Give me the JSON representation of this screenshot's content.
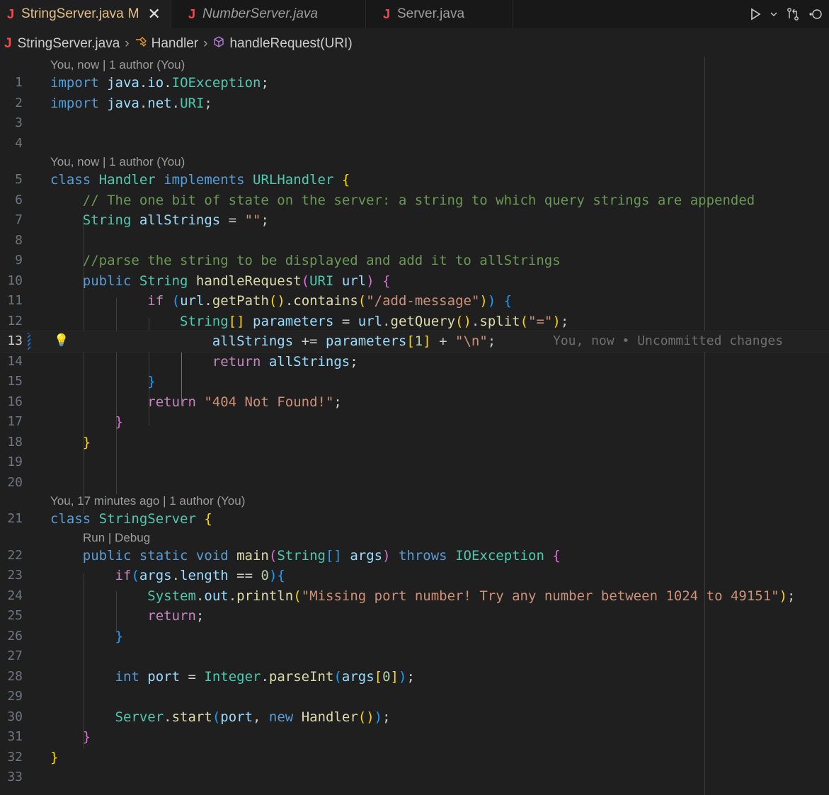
{
  "tabs": [
    {
      "icon": "J",
      "label": "StringServer.java",
      "modified": "M",
      "active": true
    },
    {
      "icon": "J",
      "label": "NumberServer.java",
      "active": false
    },
    {
      "icon": "J",
      "label": "Server.java",
      "active": false
    }
  ],
  "breadcrumb": {
    "file": "StringServer.java",
    "class": "Handler",
    "method": "handleRequest(URI)"
  },
  "codelens": {
    "handler_blame": "You, now | 1 author (You)",
    "server_blame": "You, 17 minutes ago | 1 author (You)",
    "run_debug": "Run | Debug"
  },
  "inline_blame": "You, now • Uncommitted changes",
  "current_line": 13,
  "lines": [
    {
      "n": "1",
      "tokens": [
        [
          "kw",
          "import "
        ],
        [
          "var",
          "java"
        ],
        [
          "pl",
          "."
        ],
        [
          "var",
          "io"
        ],
        [
          "pl",
          "."
        ],
        [
          "ty",
          "IOException"
        ],
        [
          "pl",
          ";"
        ]
      ]
    },
    {
      "n": "2",
      "tokens": [
        [
          "kw",
          "import "
        ],
        [
          "var",
          "java"
        ],
        [
          "pl",
          "."
        ],
        [
          "var",
          "net"
        ],
        [
          "pl",
          "."
        ],
        [
          "ty",
          "URI"
        ],
        [
          "pl",
          ";"
        ]
      ]
    },
    {
      "n": "3",
      "tokens": []
    },
    {
      "n": "4",
      "tokens": []
    },
    {
      "n": "5",
      "tokens": [
        [
          "kw",
          "class "
        ],
        [
          "ty",
          "Handler "
        ],
        [
          "kw",
          "implements "
        ],
        [
          "ty",
          "URLHandler "
        ],
        [
          "b1",
          "{"
        ]
      ]
    },
    {
      "n": "6",
      "tokens": [
        [
          "pl",
          "    "
        ],
        [
          "com",
          "// The one bit of state on the server: a string to which query strings are appended"
        ]
      ]
    },
    {
      "n": "7",
      "tokens": [
        [
          "pl",
          "    "
        ],
        [
          "ty",
          "String "
        ],
        [
          "var",
          "allStrings"
        ],
        [
          "pl",
          " = "
        ],
        [
          "str",
          "\"\""
        ],
        [
          "pl",
          ";"
        ]
      ]
    },
    {
      "n": "8",
      "tokens": []
    },
    {
      "n": "9",
      "tokens": [
        [
          "pl",
          "    "
        ],
        [
          "com",
          "//parse the string to be displayed and add it to allStrings"
        ]
      ]
    },
    {
      "n": "10",
      "tokens": [
        [
          "pl",
          "    "
        ],
        [
          "kw",
          "public "
        ],
        [
          "ty",
          "String "
        ],
        [
          "fn",
          "handleRequest"
        ],
        [
          "b2",
          "("
        ],
        [
          "ty",
          "URI "
        ],
        [
          "var",
          "url"
        ],
        [
          "b2",
          ")"
        ],
        [
          "pl",
          " "
        ],
        [
          "b2",
          "{"
        ]
      ]
    },
    {
      "n": "11",
      "tokens": [
        [
          "pl",
          "            "
        ],
        [
          "ctl",
          "if "
        ],
        [
          "b3",
          "("
        ],
        [
          "var",
          "url"
        ],
        [
          "pl",
          "."
        ],
        [
          "fn",
          "getPath"
        ],
        [
          "b1",
          "()"
        ],
        [
          "pl",
          "."
        ],
        [
          "fn",
          "contains"
        ],
        [
          "b1",
          "("
        ],
        [
          "str",
          "\"/add-message\""
        ],
        [
          "b1",
          ")"
        ],
        [
          "b3",
          ")"
        ],
        [
          "pl",
          " "
        ],
        [
          "b3",
          "{"
        ]
      ]
    },
    {
      "n": "12",
      "tokens": [
        [
          "pl",
          "                "
        ],
        [
          "ty",
          "String"
        ],
        [
          "b1",
          "[]"
        ],
        [
          "pl",
          " "
        ],
        [
          "var",
          "parameters"
        ],
        [
          "pl",
          " = "
        ],
        [
          "var",
          "url"
        ],
        [
          "pl",
          "."
        ],
        [
          "fn",
          "getQuery"
        ],
        [
          "b1",
          "()"
        ],
        [
          "pl",
          "."
        ],
        [
          "fn",
          "split"
        ],
        [
          "b1",
          "("
        ],
        [
          "str",
          "\"=\""
        ],
        [
          "b1",
          ")"
        ],
        [
          "pl",
          ";"
        ]
      ]
    },
    {
      "n": "13",
      "tokens": [
        [
          "pl",
          "                    "
        ],
        [
          "var",
          "allStrings"
        ],
        [
          "pl",
          " += "
        ],
        [
          "var",
          "parameters"
        ],
        [
          "b1",
          "["
        ],
        [
          "num",
          "1"
        ],
        [
          "b1",
          "]"
        ],
        [
          "pl",
          " + "
        ],
        [
          "str",
          "\"\\n\""
        ],
        [
          "pl",
          ";"
        ]
      ]
    },
    {
      "n": "14",
      "tokens": [
        [
          "pl",
          "                    "
        ],
        [
          "ctl",
          "return "
        ],
        [
          "var",
          "allStrings"
        ],
        [
          "pl",
          ";"
        ]
      ]
    },
    {
      "n": "15",
      "tokens": [
        [
          "pl",
          "            "
        ],
        [
          "b3",
          "}"
        ]
      ]
    },
    {
      "n": "16",
      "tokens": [
        [
          "pl",
          "            "
        ],
        [
          "ctl",
          "return "
        ],
        [
          "str",
          "\"404 Not Found!\""
        ],
        [
          "pl",
          ";"
        ]
      ]
    },
    {
      "n": "17",
      "tokens": [
        [
          "pl",
          "        "
        ],
        [
          "b2",
          "}"
        ]
      ]
    },
    {
      "n": "18",
      "tokens": [
        [
          "pl",
          "    "
        ],
        [
          "b1",
          "}"
        ]
      ]
    },
    {
      "n": "19",
      "tokens": []
    },
    {
      "n": "20",
      "tokens": []
    },
    {
      "n": "21",
      "tokens": [
        [
          "kw",
          "class "
        ],
        [
          "ty",
          "StringServer "
        ],
        [
          "b1",
          "{"
        ]
      ]
    },
    {
      "n": "22",
      "tokens": [
        [
          "pl",
          "    "
        ],
        [
          "kw",
          "public static void "
        ],
        [
          "fn",
          "main"
        ],
        [
          "b2",
          "("
        ],
        [
          "ty",
          "String"
        ],
        [
          "b3",
          "[]"
        ],
        [
          "pl",
          " "
        ],
        [
          "var",
          "args"
        ],
        [
          "b2",
          ")"
        ],
        [
          "pl",
          " "
        ],
        [
          "kw",
          "throws "
        ],
        [
          "ty",
          "IOException "
        ],
        [
          "b2",
          "{"
        ]
      ]
    },
    {
      "n": "23",
      "tokens": [
        [
          "pl",
          "        "
        ],
        [
          "ctl",
          "if"
        ],
        [
          "b3",
          "("
        ],
        [
          "var",
          "args"
        ],
        [
          "pl",
          "."
        ],
        [
          "var",
          "length"
        ],
        [
          "pl",
          " == "
        ],
        [
          "num",
          "0"
        ],
        [
          "b3",
          ")"
        ],
        [
          "b3",
          "{"
        ]
      ]
    },
    {
      "n": "24",
      "tokens": [
        [
          "pl",
          "            "
        ],
        [
          "ty",
          "System"
        ],
        [
          "pl",
          "."
        ],
        [
          "var",
          "out"
        ],
        [
          "pl",
          "."
        ],
        [
          "fn",
          "println"
        ],
        [
          "b1",
          "("
        ],
        [
          "str",
          "\"Missing port number! Try any number between 1024 to 49151\""
        ],
        [
          "b1",
          ")"
        ],
        [
          "pl",
          ";"
        ]
      ]
    },
    {
      "n": "25",
      "tokens": [
        [
          "pl",
          "            "
        ],
        [
          "ctl",
          "return"
        ],
        [
          "pl",
          ";"
        ]
      ]
    },
    {
      "n": "26",
      "tokens": [
        [
          "pl",
          "        "
        ],
        [
          "b3",
          "}"
        ]
      ]
    },
    {
      "n": "27",
      "tokens": []
    },
    {
      "n": "28",
      "tokens": [
        [
          "pl",
          "        "
        ],
        [
          "kw",
          "int "
        ],
        [
          "var",
          "port"
        ],
        [
          "pl",
          " = "
        ],
        [
          "ty",
          "Integer"
        ],
        [
          "pl",
          "."
        ],
        [
          "fn",
          "parseInt"
        ],
        [
          "b3",
          "("
        ],
        [
          "var",
          "args"
        ],
        [
          "b1",
          "["
        ],
        [
          "num",
          "0"
        ],
        [
          "b1",
          "]"
        ],
        [
          "b3",
          ")"
        ],
        [
          "pl",
          ";"
        ]
      ]
    },
    {
      "n": "29",
      "tokens": []
    },
    {
      "n": "30",
      "tokens": [
        [
          "pl",
          "        "
        ],
        [
          "ty",
          "Server"
        ],
        [
          "pl",
          "."
        ],
        [
          "fn",
          "start"
        ],
        [
          "b3",
          "("
        ],
        [
          "var",
          "port"
        ],
        [
          "pl",
          ", "
        ],
        [
          "kw",
          "new "
        ],
        [
          "fn",
          "Handler"
        ],
        [
          "b1",
          "()"
        ],
        [
          "b3",
          ")"
        ],
        [
          "pl",
          ";"
        ]
      ]
    },
    {
      "n": "31",
      "tokens": [
        [
          "pl",
          "    "
        ],
        [
          "b2",
          "}"
        ]
      ]
    },
    {
      "n": "32",
      "tokens": [
        [
          "b1",
          "}"
        ]
      ]
    },
    {
      "n": "33",
      "tokens": []
    }
  ]
}
